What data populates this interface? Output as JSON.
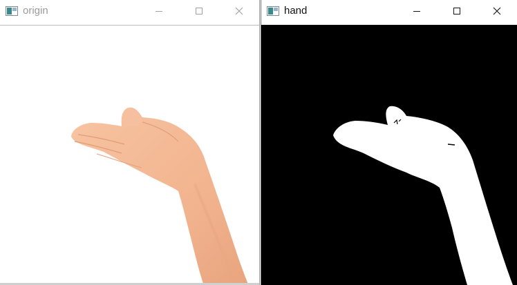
{
  "windows": [
    {
      "title": "origin",
      "active": false,
      "controls": {
        "minimize": "minimize-icon",
        "maximize": "maximize-icon",
        "close": "close-icon"
      }
    },
    {
      "title": "hand",
      "active": true,
      "controls": {
        "minimize": "minimize-icon",
        "maximize": "maximize-icon",
        "close": "close-icon"
      }
    }
  ],
  "colors": {
    "skin": "#f2b48f",
    "skin_shadow": "#e09872",
    "mask_background": "#000000",
    "mask_foreground": "#ffffff",
    "inactive_title": "#9a9a9a",
    "active_title": "#111111"
  }
}
